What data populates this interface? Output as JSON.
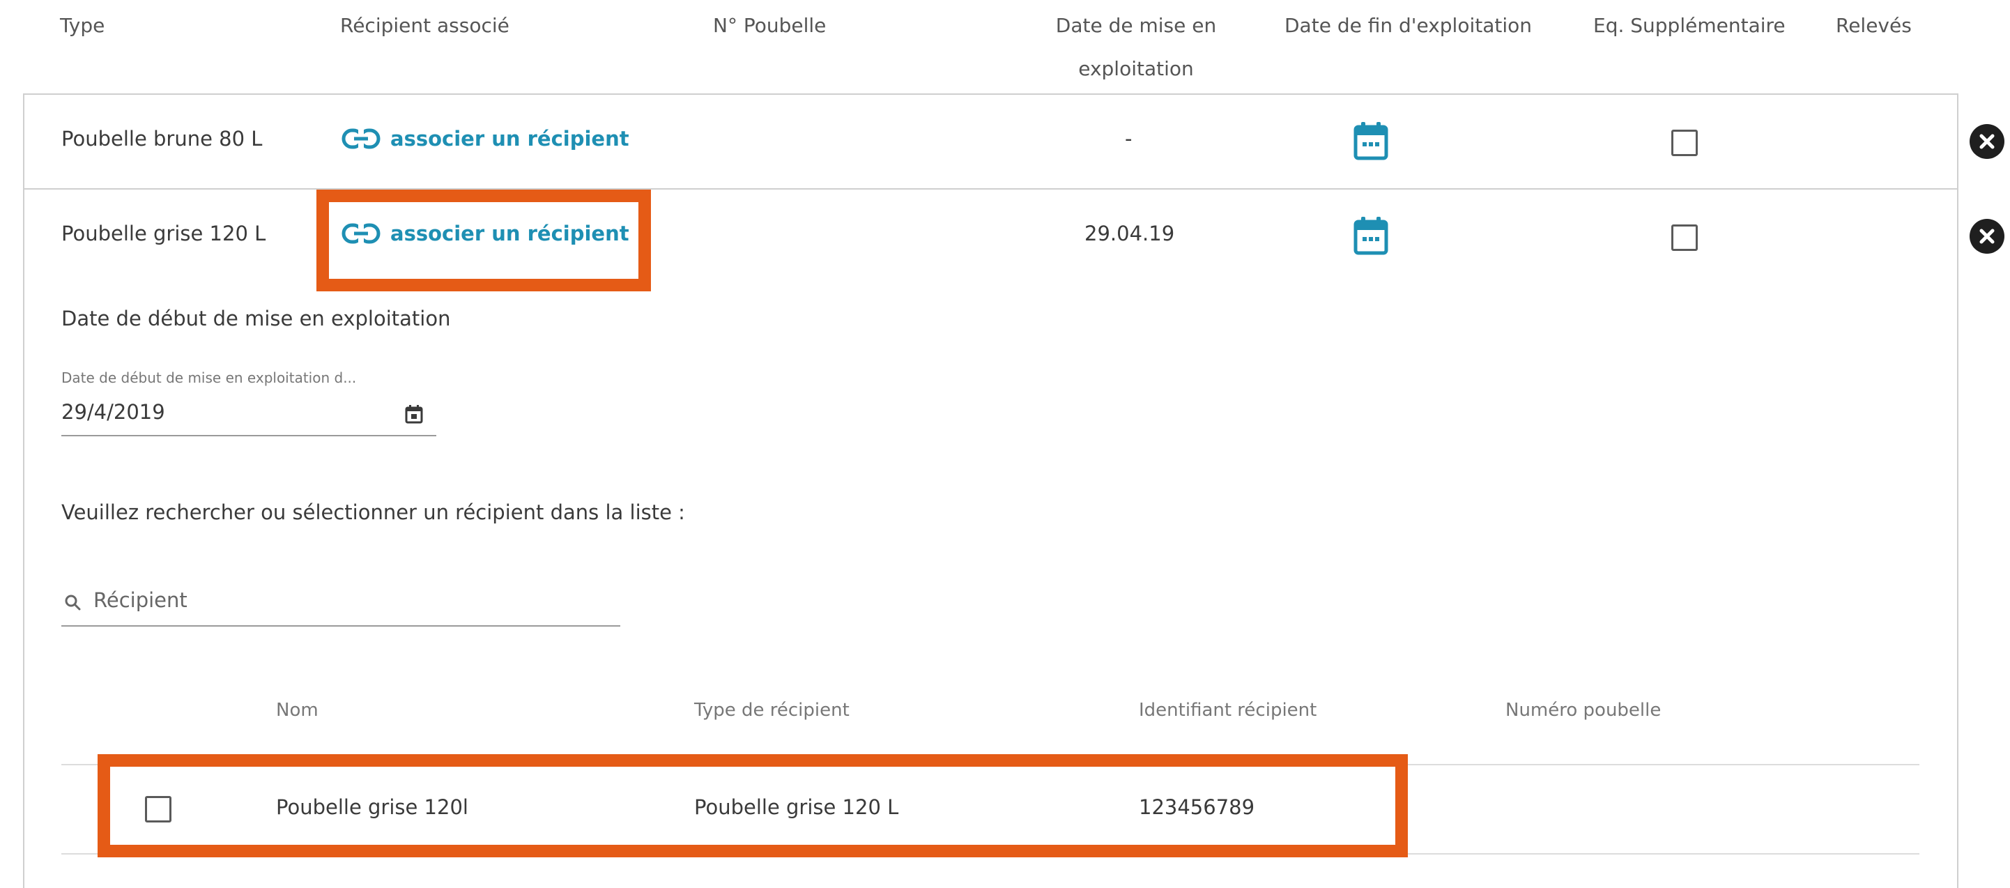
{
  "headers": {
    "type": "Type",
    "recipient": "Récipient associé",
    "bin_number": "N° Poubelle",
    "start_date": "Date de mise en exploitation",
    "end_date": "Date de fin d'exploitation",
    "extra": "Eq. Supplémentaire",
    "readings": "Relevés"
  },
  "rows": [
    {
      "type": "Poubelle brune 80 L",
      "link": "associer un récipient",
      "start_date": "-"
    },
    {
      "type": "Poubelle grise 120 L",
      "link": "associer un récipient",
      "start_date": "29.04.19"
    }
  ],
  "detail": {
    "section_label": "Date de début de mise en exploitation",
    "date_field_label": "Date de début de mise en exploitation d...",
    "date_value": "29/4/2019",
    "instruction": "Veuillez rechercher ou sélectionner un récipient dans la liste :",
    "search_placeholder": "Récipient",
    "table_headers": {
      "name": "Nom",
      "type": "Type de récipient",
      "identifier": "Identifiant récipient",
      "bin_number": "Numéro poubelle"
    },
    "table_rows": [
      {
        "name": "Poubelle grise 120l",
        "type": "Poubelle grise 120 L",
        "identifier": "123456789",
        "bin_number": ""
      }
    ]
  },
  "icons": {
    "link": "link-chain-icon",
    "calendar": "calendar-icon",
    "close": "close-circle-icon",
    "search": "search-icon"
  },
  "colors": {
    "accent": "#1e8fb3",
    "highlight": "#e55b16",
    "border": "#cfcfcf"
  }
}
